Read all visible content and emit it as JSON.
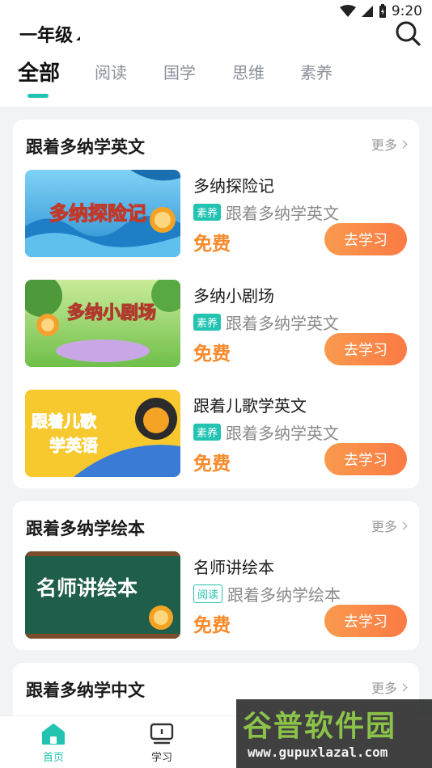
{
  "status": {
    "time": "9:20"
  },
  "header": {
    "grade": "一年级"
  },
  "tabs": [
    "全部",
    "阅读",
    "国学",
    "思维",
    "素养"
  ],
  "sections": [
    {
      "title": "跟着多纳学英文",
      "more": "更多",
      "items": [
        {
          "title": "多纳探险记",
          "badge": "素养",
          "sub": "跟着多纳学英文",
          "price": "免费",
          "button": "去学习",
          "thumb_text": "多纳探险记"
        },
        {
          "title": "多纳小剧场",
          "badge": "素养",
          "sub": "跟着多纳学英文",
          "price": "免费",
          "button": "去学习",
          "thumb_text": "多纳小剧场"
        },
        {
          "title": "跟着儿歌学英文",
          "badge": "素养",
          "sub": "跟着多纳学英文",
          "price": "免费",
          "button": "去学习",
          "thumb_text_1": "跟着儿歌",
          "thumb_text_2": "学英语"
        }
      ]
    },
    {
      "title": "跟着多纳学绘本",
      "more": "更多",
      "items": [
        {
          "title": "名师讲绘本",
          "badge": "阅读",
          "sub": "跟着多纳学绘本",
          "price": "免费",
          "button": "去学习",
          "thumb_text": "名师讲绘本"
        }
      ]
    },
    {
      "title": "跟着多纳学中文",
      "more": "更多"
    }
  ],
  "bottom_nav": [
    {
      "label": "首页",
      "icon": "home-icon",
      "active": true
    },
    {
      "label": "学习",
      "icon": "study-icon",
      "active": false
    }
  ],
  "watermark": {
    "big": "谷普软件园",
    "small": "www.gupuxlazal.com"
  },
  "colors": {
    "accent": "#22c3b0",
    "price": "#f78a2b",
    "button": "#fb7a44"
  }
}
